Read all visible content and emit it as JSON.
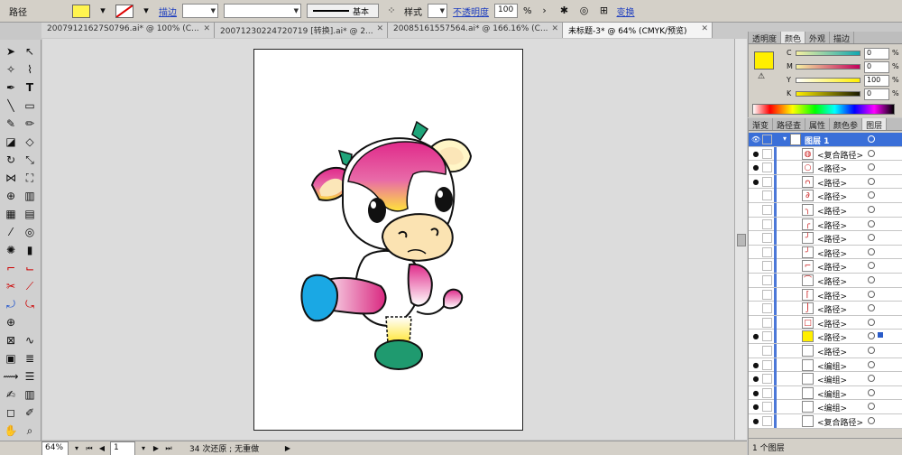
{
  "control_bar": {
    "path_label": "路径",
    "stroke_link": "描边",
    "stroke_style": "基本",
    "style_label": "样式",
    "opacity_link": "不透明度",
    "opacity_value": "100",
    "opacity_unit": "%",
    "transform_link": "变换",
    "fill_color": "#fff44f",
    "link_color": "#1d3dbf"
  },
  "doc_tabs": [
    {
      "label": "20079121627S0796.ai* @ 100% (C..."
    },
    {
      "label": "20071230224720719 [转换].ai* @ 2..."
    },
    {
      "label": "20085161557564.ai* @ 166.16% (C..."
    },
    {
      "label": "未标题-3* @ 64% (CMYK/预览)"
    }
  ],
  "color_panel": {
    "tabs": [
      "透明度",
      "颜色",
      "外观",
      "描边"
    ],
    "channels": [
      {
        "name": "C",
        "value": "0"
      },
      {
        "name": "M",
        "value": "0"
      },
      {
        "name": "Y",
        "value": "100"
      },
      {
        "name": "K",
        "value": "0"
      }
    ],
    "percent": "%",
    "current_color": "#ffef00"
  },
  "layers_panel": {
    "tabs": [
      "渐变",
      "路径查",
      "属性",
      "颜色参",
      "图层"
    ],
    "header_layer": "图层 1",
    "rows": [
      "<复合路径>",
      "<路径>",
      "<路径>",
      "<路径>",
      "<路径>",
      "<路径>",
      "<路径>",
      "<路径>",
      "<路径>",
      "<路径>",
      "<路径>",
      "<路径>",
      "<路径>",
      "<路径>",
      "<路径>",
      "<编组>",
      "<编组>",
      "<编组>",
      "<编组>",
      "<复合路径>"
    ],
    "layer_count": "1 个图层"
  },
  "status_bar": {
    "zoom": "64%",
    "page": "1",
    "info": "34 次还原 ; 无重做"
  }
}
